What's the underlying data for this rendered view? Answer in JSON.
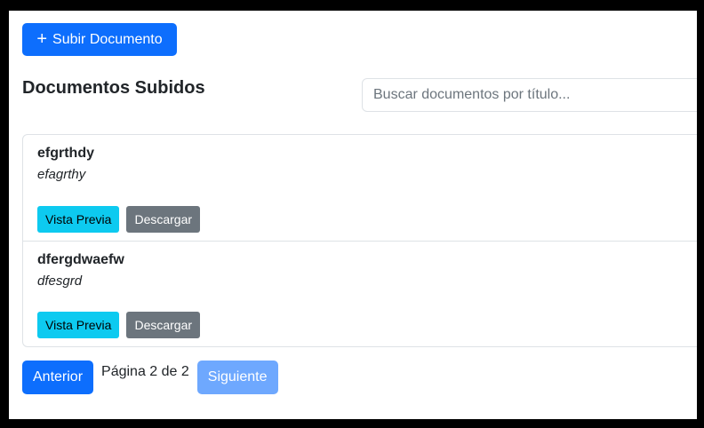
{
  "toolbar": {
    "upload_label": "Subir Documento",
    "upload_icon": "plus-icon"
  },
  "header": {
    "title": "Documentos Subidos"
  },
  "search": {
    "placeholder": "Buscar documentos por título..."
  },
  "documents": [
    {
      "title": "efgrthdy",
      "description": "efagrthy",
      "preview_label": "Vista Previa",
      "download_label": "Descargar"
    },
    {
      "title": "dfergdwaefw",
      "description": "dfesgrd",
      "preview_label": "Vista Previa",
      "download_label": "Descargar"
    }
  ],
  "pagination": {
    "prev_label": "Anterior",
    "info": "Página 2 de 2",
    "next_label": "Siguiente"
  },
  "colors": {
    "primary": "#0d6efd",
    "info": "#0dcaf0",
    "secondary": "#6c757d",
    "primary_disabled": "#6ea8fe"
  }
}
